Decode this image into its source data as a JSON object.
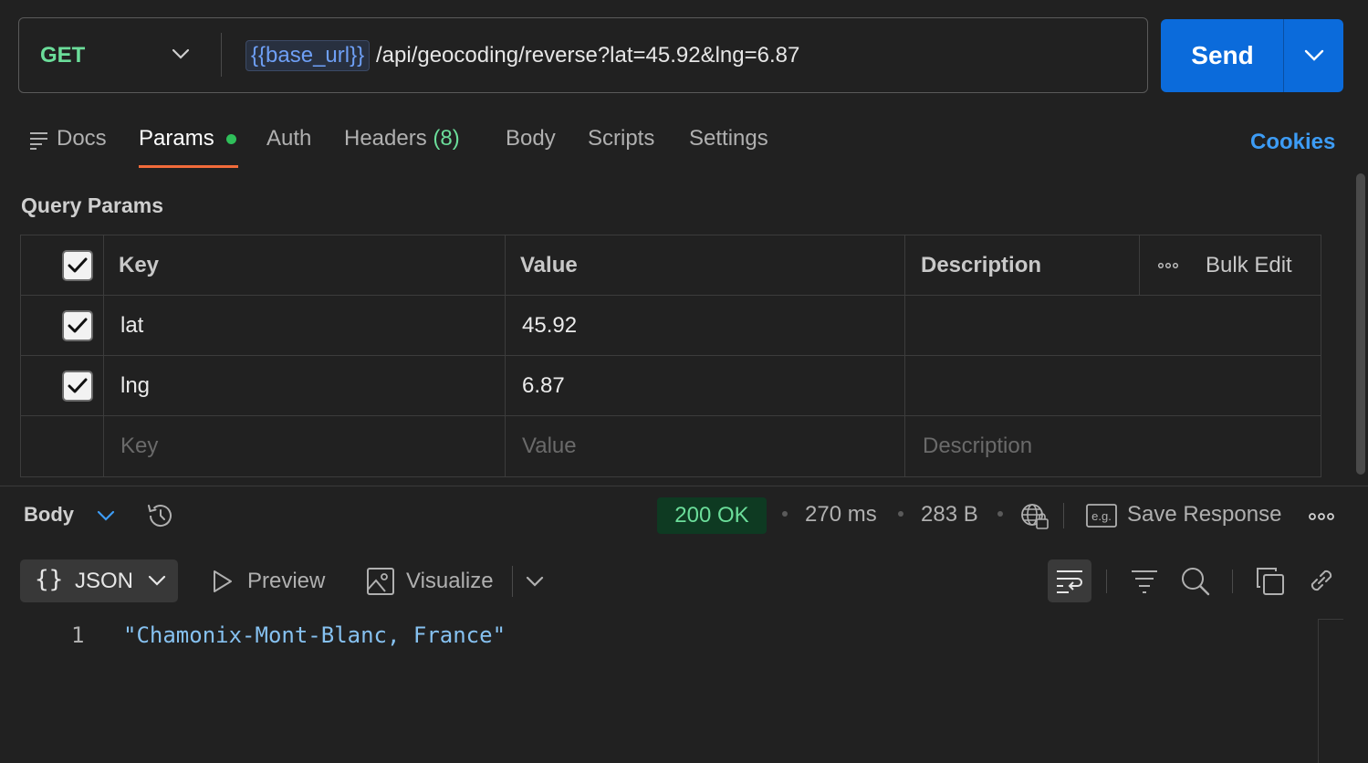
{
  "request": {
    "method": "GET",
    "url_variable": "{{base_url}}",
    "url_path": "/api/geocoding/reverse?lat=45.92&lng=6.87",
    "send_label": "Send"
  },
  "tabs": [
    {
      "label": "Docs"
    },
    {
      "label": "Params",
      "active": true
    },
    {
      "label": "Auth"
    },
    {
      "label": "Headers",
      "count": "(8)"
    },
    {
      "label": "Body"
    },
    {
      "label": "Scripts"
    },
    {
      "label": "Settings"
    }
  ],
  "cookies_label": "Cookies",
  "query_params": {
    "title": "Query Params",
    "headers": {
      "key": "Key",
      "value": "Value",
      "description": "Description",
      "bulk_edit": "Bulk Edit"
    },
    "rows": [
      {
        "checked": true,
        "key": "lat",
        "value": "45.92",
        "description": ""
      },
      {
        "checked": true,
        "key": "lng",
        "value": "6.87",
        "description": ""
      }
    ],
    "placeholder": {
      "key": "Key",
      "value": "Value",
      "description": "Description"
    }
  },
  "response": {
    "section_label": "Body",
    "status": "200 OK",
    "time": "270 ms",
    "size": "283 B",
    "save_response": "Save Response",
    "format": "JSON",
    "preview": "Preview",
    "visualize": "Visualize",
    "line_numbers": [
      "1"
    ],
    "lines": [
      "\"Chamonix-Mont-Blanc, France\""
    ]
  },
  "colors": {
    "background": "#212121",
    "method_green": "#6bdd9a",
    "send_blue": "#0b6bdb",
    "active_tab_underline": "#f26b3a",
    "link_blue": "#3d9cf5",
    "status_bg": "#0e3a22"
  }
}
